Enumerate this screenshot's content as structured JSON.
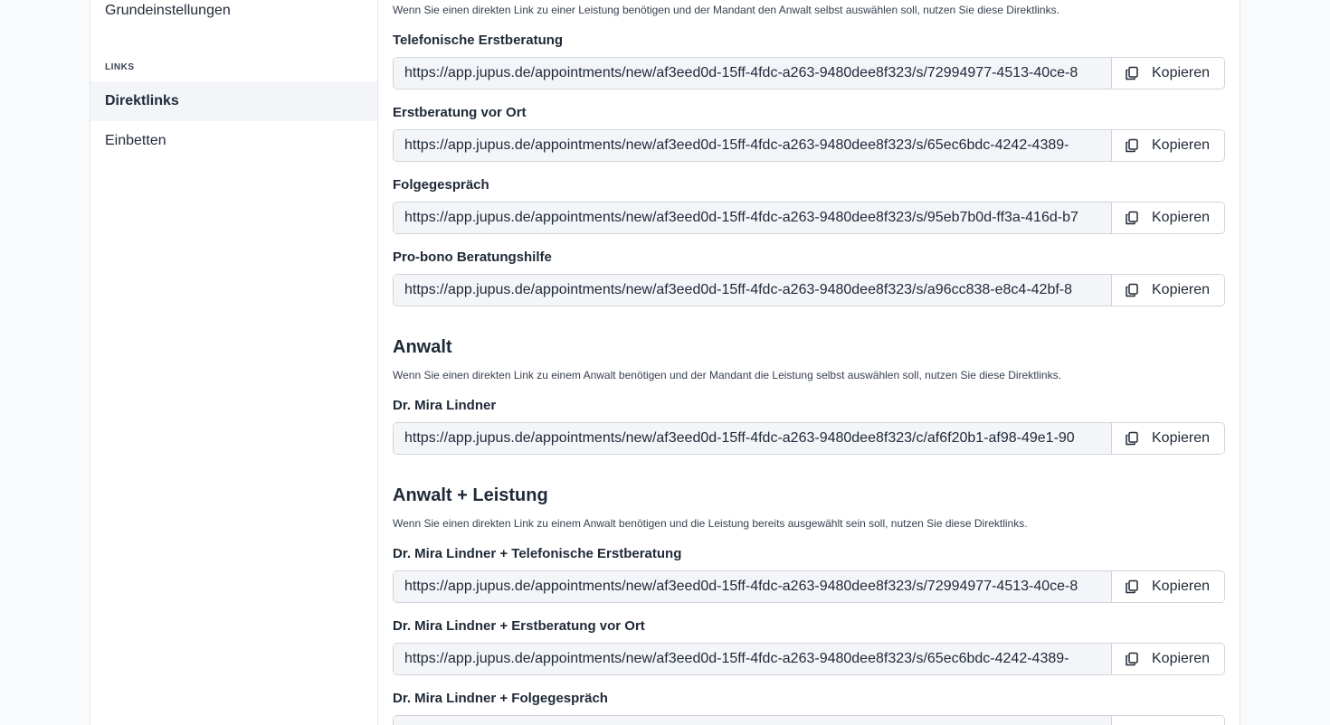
{
  "sidebar": {
    "top_item": "Grundeinstellungen",
    "section_label": "LINKS",
    "items": [
      {
        "label": "Direktlinks",
        "active": true
      },
      {
        "label": "Einbetten",
        "active": false
      }
    ]
  },
  "copy_label": "Kopieren",
  "leistung": {
    "description": "Wenn Sie einen direkten Link zu einer Leistung benötigen und der Mandant den Anwalt selbst auswählen soll, nutzen Sie diese Direktlinks.",
    "links": [
      {
        "label": "Telefonische Erstberatung",
        "url": "https://app.jupus.de/appointments/new/af3eed0d-15ff-4fdc-a263-9480dee8f323/s/72994977-4513-40ce-8"
      },
      {
        "label": "Erstberatung vor Ort",
        "url": "https://app.jupus.de/appointments/new/af3eed0d-15ff-4fdc-a263-9480dee8f323/s/65ec6bdc-4242-4389-"
      },
      {
        "label": "Folgegespräch",
        "url": "https://app.jupus.de/appointments/new/af3eed0d-15ff-4fdc-a263-9480dee8f323/s/95eb7b0d-ff3a-416d-b7"
      },
      {
        "label": "Pro-bono Beratungshilfe",
        "url": "https://app.jupus.de/appointments/new/af3eed0d-15ff-4fdc-a263-9480dee8f323/s/a96cc838-e8c4-42bf-8"
      }
    ]
  },
  "anwalt": {
    "title": "Anwalt",
    "description": "Wenn Sie einen direkten Link zu einem Anwalt benötigen und der Mandant die Leistung selbst auswählen soll, nutzen Sie diese Direktlinks.",
    "links": [
      {
        "label": "Dr. Mira Lindner",
        "url": "https://app.jupus.de/appointments/new/af3eed0d-15ff-4fdc-a263-9480dee8f323/c/af6f20b1-af98-49e1-90"
      }
    ]
  },
  "anwalt_leistung": {
    "title": "Anwalt + Leistung",
    "description": "Wenn Sie einen direkten Link zu einem Anwalt benötigen und die Leistung bereits ausgewählt sein soll, nutzen Sie diese Direktlinks.",
    "links": [
      {
        "label": "Dr. Mira Lindner + Telefonische Erstberatung",
        "url": "https://app.jupus.de/appointments/new/af3eed0d-15ff-4fdc-a263-9480dee8f323/s/72994977-4513-40ce-8"
      },
      {
        "label": "Dr. Mira Lindner + Erstberatung vor Ort",
        "url": "https://app.jupus.de/appointments/new/af3eed0d-15ff-4fdc-a263-9480dee8f323/s/65ec6bdc-4242-4389-"
      },
      {
        "label": "Dr. Mira Lindner + Folgegespräch",
        "url": ""
      }
    ]
  }
}
